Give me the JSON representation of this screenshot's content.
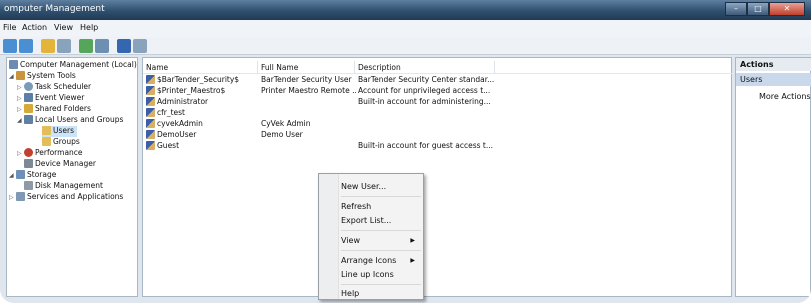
{
  "window": {
    "title": "omputer Management",
    "buttons": [
      "–",
      "□",
      "✕"
    ]
  },
  "menu": {
    "items": [
      "File",
      "Action",
      "View",
      "Help"
    ]
  },
  "toolbar": {
    "icons": [
      "back-arrow-icon",
      "forward-arrow-icon",
      "up-folder-icon",
      "show-hide-tree-icon",
      "refresh-icon",
      "export-list-icon",
      "help-icon",
      "properties-icon"
    ]
  },
  "tree": {
    "items": [
      "Computer Management (Local)",
      "System Tools",
      "Task Scheduler",
      "Event Viewer",
      "Shared Folders",
      "Local Users and Groups",
      "Users",
      "Groups",
      "Performance",
      "Device Manager",
      "Storage",
      "Disk Management",
      "Services and Applications"
    ]
  },
  "list": {
    "columns": [
      "Name",
      "Full Name",
      "Description"
    ],
    "rows": [
      {
        "name": "$BarTender_Security$",
        "full_name": "BarTender Security User",
        "description": "BarTender Security Center standar..."
      },
      {
        "name": "$Printer_Maestro$",
        "full_name": "Printer Maestro Remote ...",
        "description": "Account for unprivileged access t..."
      },
      {
        "name": "Administrator",
        "full_name": "",
        "description": "Built-in account for administering..."
      },
      {
        "name": "cfr_test",
        "full_name": "",
        "description": ""
      },
      {
        "name": "cyvekAdmin",
        "full_name": "CyVek Admin",
        "description": ""
      },
      {
        "name": "DemoUser",
        "full_name": "Demo User",
        "description": ""
      },
      {
        "name": "Guest",
        "full_name": "",
        "description": "Built-in account for guest access t..."
      }
    ]
  },
  "actions": {
    "header": "Actions",
    "section": "Users",
    "more": "More Actions"
  },
  "context_menu": {
    "items": [
      "New User...",
      "Refresh",
      "Export List...",
      "View",
      "Arrange Icons",
      "Line up Icons",
      "Help"
    ]
  }
}
